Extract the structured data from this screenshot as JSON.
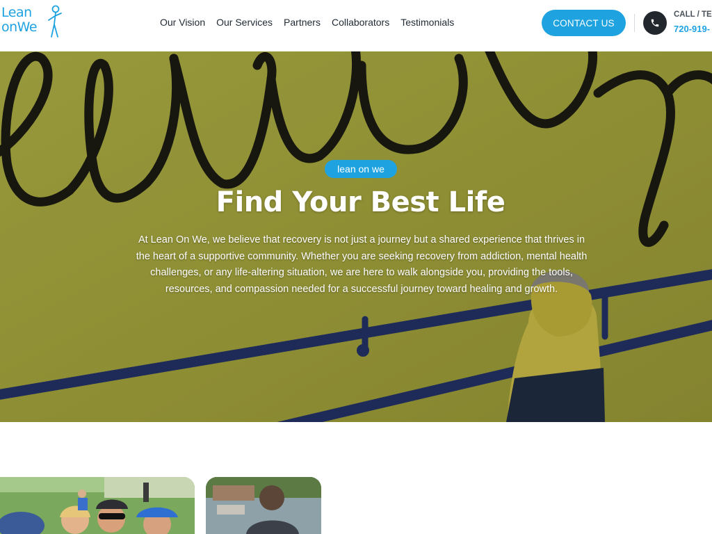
{
  "header": {
    "logo": {
      "line1": "Lean",
      "line2": "onWe",
      "figure_icon": "person-leaning-icon"
    },
    "nav": [
      {
        "label": "Our Vision"
      },
      {
        "label": "Our Services"
      },
      {
        "label": "Partners"
      },
      {
        "label": "Collaborators"
      },
      {
        "label": "Testimonials"
      }
    ],
    "contact_button": "CONTACT US",
    "phone_icon": "phone-icon",
    "call_label": "CALL / TEX",
    "phone_number": "720-919-"
  },
  "hero": {
    "badge": "lean on we",
    "title": "Find Your Best Life",
    "body": "At Lean On We, we believe that recovery is not just a journey but a shared experience that thrives in the heart of a supportive community. Whether you are seeking recovery from addiction, mental health challenges, or any life-altering situation, we are here to walk alongside you, providing the tools, resources, and compassion needed for a successful journey toward healing and growth."
  },
  "colors": {
    "accent": "#1ea3e0",
    "text_dark": "#1f2933",
    "hero_wall": "#a9a93f"
  }
}
